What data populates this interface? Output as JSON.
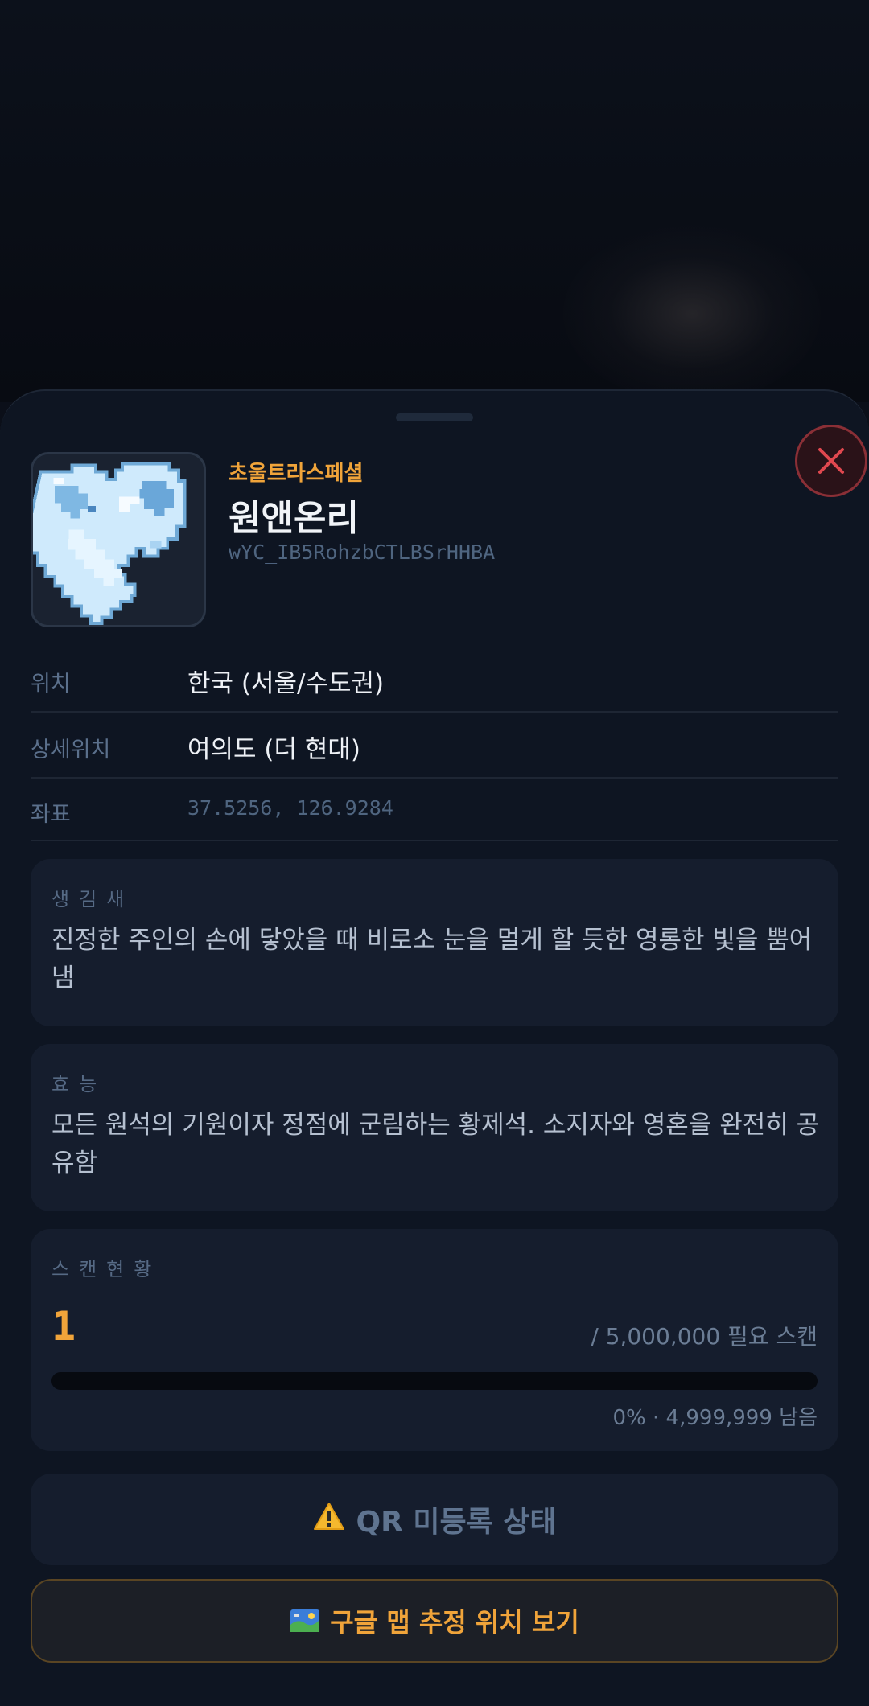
{
  "item": {
    "rarity": "초울트라스페셜",
    "name": "원앤온리",
    "code": "wYC_IB5RohzbCTLBSrHHBA"
  },
  "info": [
    {
      "label": "위치",
      "value": "한국 (서울/수도권)"
    },
    {
      "label": "상세위치",
      "value": "여의도 (더 현대)"
    },
    {
      "label": "좌표",
      "value": "37.5256, 126.9284"
    }
  ],
  "appearance": {
    "title": "생김새",
    "text": "진정한 주인의 손에 닿았을 때 비로소 눈을 멀게 할 듯한 영롱한 빛을 뿜어냄"
  },
  "effect": {
    "title": "효능",
    "text": "모든 원석의 기원이자 정점에 군림하는 황제석. 소지자와 영혼을 완전히 공유함"
  },
  "scan": {
    "title": "스캔현황",
    "count": "1",
    "required": "/ 5,000,000 필요 스캔",
    "remaining": "0% · 4,999,999 남음",
    "progress_fraction": 2e-07
  },
  "qr_status": {
    "icon": "warning-icon",
    "label": "QR 미등록 상태"
  },
  "map_button": {
    "icon": "map-icon",
    "label": "구글 맵 추정 위치 보기"
  },
  "colors": {
    "accent": "#f0a43a",
    "background": "#0e1522",
    "card": "#151d2d",
    "close": "#e0484f"
  }
}
